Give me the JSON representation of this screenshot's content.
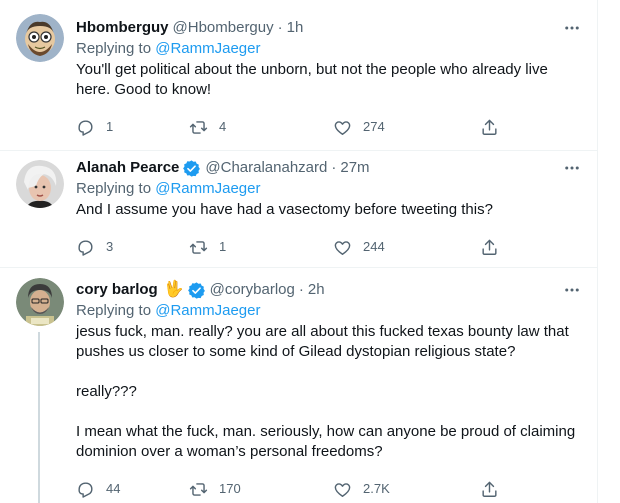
{
  "tweets": [
    {
      "name": "Hbomberguy",
      "handle": "@Hbomberguy",
      "separator": "·",
      "time": "1h",
      "replying_prefix": "Replying to ",
      "replying_to": "@RammJaeger",
      "paragraphs": [
        "You'll get political about the unborn, but not the people who already live here. Good to know!"
      ],
      "replies": "1",
      "retweets": "4",
      "likes": "274",
      "verified": false
    },
    {
      "name": "Alanah Pearce",
      "handle": "@Charalanahzard",
      "separator": "·",
      "time": "27m",
      "replying_prefix": "Replying to ",
      "replying_to": "@RammJaeger",
      "paragraphs": [
        "And I assume you have had a vasectomy before tweeting this?"
      ],
      "replies": "3",
      "retweets": "1",
      "likes": "244",
      "verified": true
    },
    {
      "name": "cory barlog",
      "name_emoji": "🖖",
      "handle": "@corybarlog",
      "separator": "·",
      "time": "2h",
      "replying_prefix": "Replying to ",
      "replying_to": "@RammJaeger",
      "paragraphs": [
        "jesus fuck, man. really? you are all about this fucked texas bounty law that pushes us closer to some kind of Gilead dystopian religious state?",
        "really???",
        "I mean what the fuck, man. seriously, how can anyone be proud of claiming dominion over a woman’s personal freedoms?"
      ],
      "replies": "44",
      "retweets": "170",
      "likes": "2.7K",
      "verified": true
    }
  ],
  "colors": {
    "accent": "#1d9bf0",
    "secondary_text": "#536471",
    "border": "#eff3f4"
  },
  "icons": {
    "reply": "reply-icon",
    "retweet": "retweet-icon",
    "like": "heart-icon",
    "share": "share-icon",
    "more": "more-icon",
    "verified": "verified-badge-icon"
  }
}
